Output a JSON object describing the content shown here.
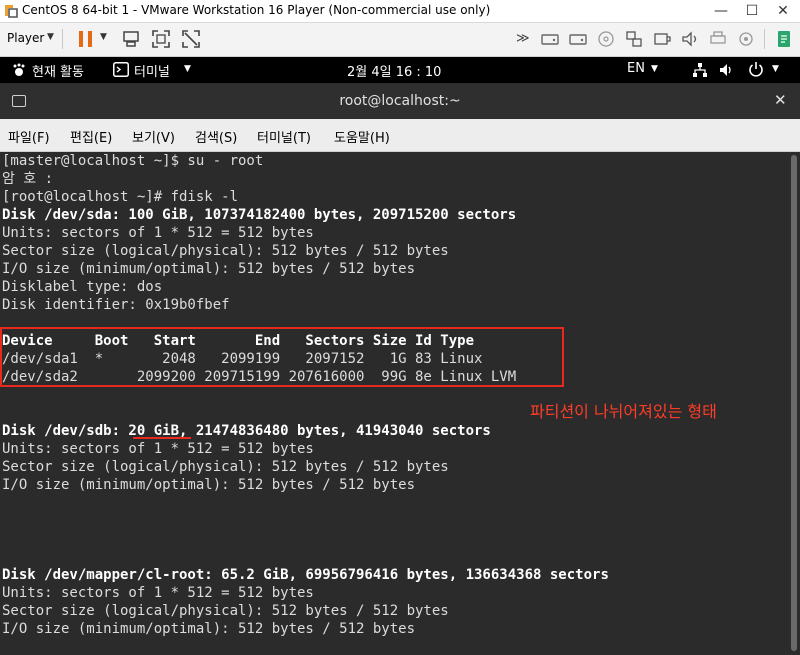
{
  "vmware": {
    "window_title": "CentOS 8 64-bit 1 - VMware Workstation 16 Player (Non-commercial use only)",
    "minimize": "—",
    "maximize": "☐",
    "close": "✕",
    "player_menu": "Player"
  },
  "gnome": {
    "activities": "현재 활동",
    "app_menu": "터미널",
    "clock": "2월 4일  16 : 10",
    "lang": "EN"
  },
  "terminal": {
    "title": "root@localhost:~",
    "close": "✕",
    "menu": [
      "파일(F)",
      "편집(E)",
      "보기(V)",
      "검색(S)",
      "터미널(T)",
      "도움말(H)"
    ],
    "lines": [
      {
        "text": "[master@localhost ~]$ su - root",
        "bold": false
      },
      {
        "text": "암 호 :",
        "bold": false
      },
      {
        "text": "[root@localhost ~]# fdisk -l",
        "bold": false
      },
      {
        "text": "Disk /dev/sda: 100 GiB, 107374182400 bytes, 209715200 sectors",
        "bold": true
      },
      {
        "text": "Units: sectors of 1 * 512 = 512 bytes",
        "bold": false
      },
      {
        "text": "Sector size (logical/physical): 512 bytes / 512 bytes",
        "bold": false
      },
      {
        "text": "I/O size (minimum/optimal): 512 bytes / 512 bytes",
        "bold": false
      },
      {
        "text": "Disklabel type: dos",
        "bold": false
      },
      {
        "text": "Disk identifier: 0x19b0fbef",
        "bold": false
      },
      {
        "text": "",
        "bold": false
      },
      {
        "text": "Device     Boot   Start       End   Sectors Size Id Type",
        "bold": true
      },
      {
        "text": "/dev/sda1  *       2048   2099199   2097152   1G 83 Linux",
        "bold": false
      },
      {
        "text": "/dev/sda2       2099200 209715199 207616000  99G 8e Linux LVM",
        "bold": false
      },
      {
        "text": "",
        "bold": false
      },
      {
        "text": "",
        "bold": false
      },
      {
        "text": "Disk /dev/sdb: 20 GiB, 21474836480 bytes, 41943040 sectors",
        "bold": true
      },
      {
        "text": "Units: sectors of 1 * 512 = 512 bytes",
        "bold": false
      },
      {
        "text": "Sector size (logical/physical): 512 bytes / 512 bytes",
        "bold": false
      },
      {
        "text": "I/O size (minimum/optimal): 512 bytes / 512 bytes",
        "bold": false
      },
      {
        "text": "",
        "bold": false
      },
      {
        "text": "",
        "bold": false
      },
      {
        "text": "",
        "bold": false
      },
      {
        "text": "",
        "bold": false
      },
      {
        "text": "Disk /dev/mapper/cl-root: 65.2 GiB, 69956796416 bytes, 136634368 sectors",
        "bold": true
      },
      {
        "text": "Units: sectors of 1 * 512 = 512 bytes",
        "bold": false
      },
      {
        "text": "Sector size (logical/physical): 512 bytes / 512 bytes",
        "bold": false
      },
      {
        "text": "I/O size (minimum/optimal): 512 bytes / 512 bytes",
        "bold": false
      }
    ]
  },
  "annotation": {
    "text": "파티션이 나뉘어져있는 형태",
    "color": "#ff3c28"
  }
}
